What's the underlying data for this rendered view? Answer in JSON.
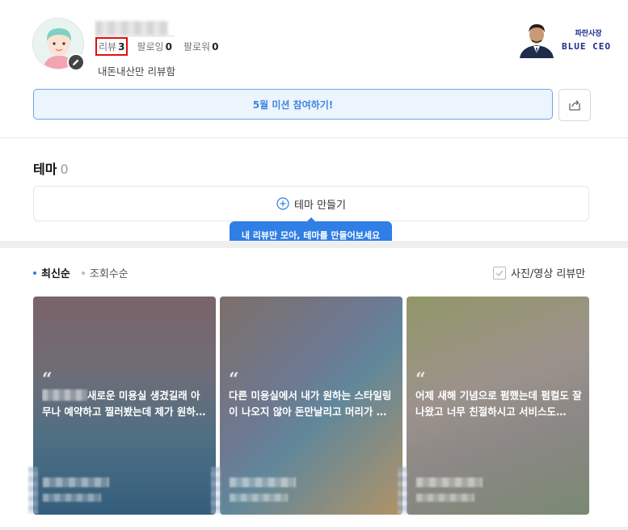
{
  "profile": {
    "stats": [
      {
        "label": "리뷰",
        "value": "3"
      },
      {
        "label": "팔로잉",
        "value": "0"
      },
      {
        "label": "팔로워",
        "value": "0"
      }
    ],
    "bio": "내돈내산만 리뷰함",
    "brand_top": "파란사장",
    "brand_bottom": "BLUE CEO"
  },
  "mission_button": "5월 미션 참여하기!",
  "theme": {
    "title": "테마",
    "count": "0",
    "create_label": "테마 만들기",
    "tooltip": "내 리뷰만 모아, 테마를 만들어보세요"
  },
  "sort": {
    "latest": "최신순",
    "views": "조회수순"
  },
  "photo_filter_label": "사진/영상 리뷰만",
  "cards": [
    {
      "text": "새로운 미용실 생겼길래 아무나 예약하고 찔러봤는데 제가 원하…"
    },
    {
      "text": "다른 미용실에서 내가 원하는 스타일링이 나오지 않아 돈만날리고 머리가 …"
    },
    {
      "text": "어제 새해 기념으로 펌했는데 펌컬도 잘나왔고 너무 친절하시고 서비스도…"
    }
  ],
  "colors": {
    "accent": "#2f7fe6",
    "highlight": "#e01010"
  }
}
